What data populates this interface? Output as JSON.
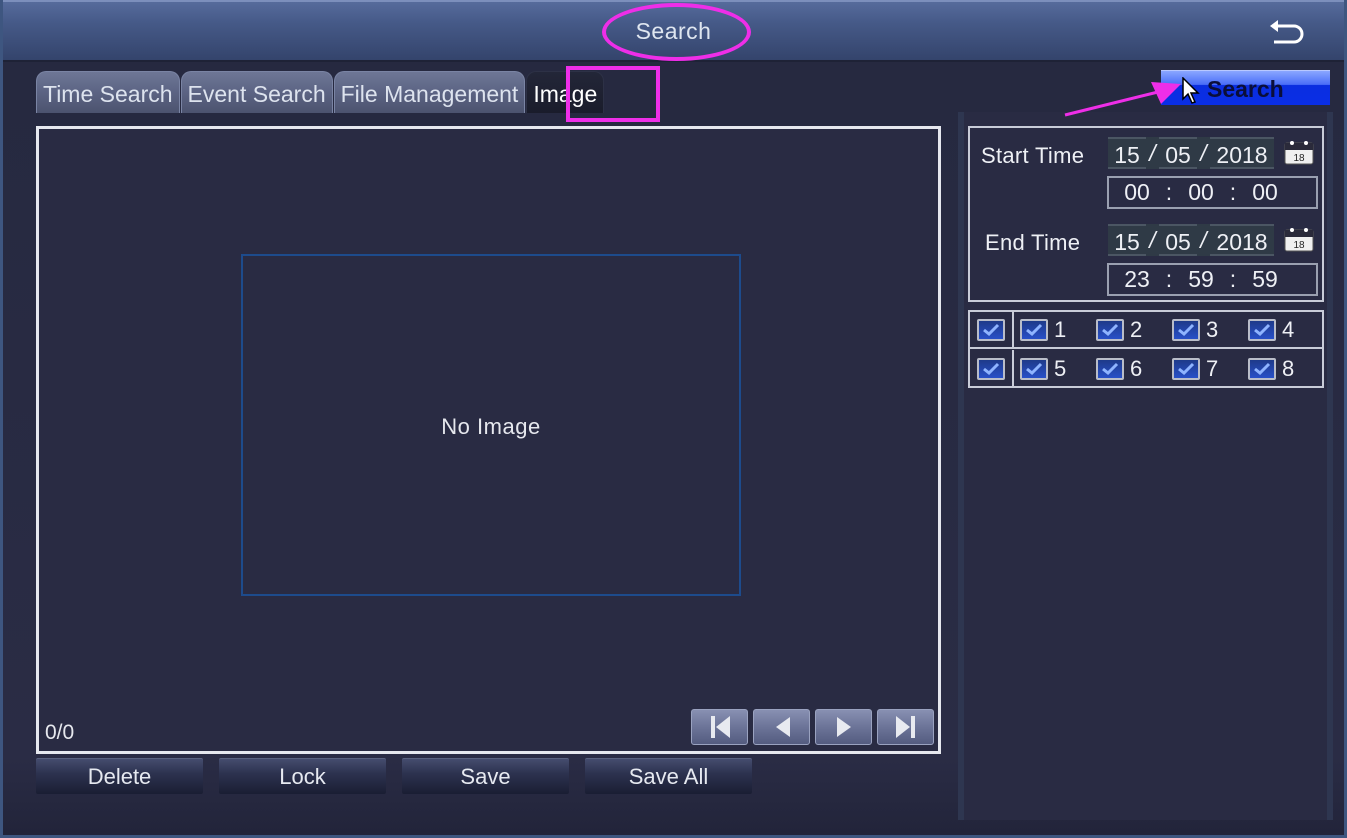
{
  "window": {
    "title": "Search",
    "back_icon": "return-arrow-icon"
  },
  "tabs": [
    {
      "label": "Time Search",
      "active": false
    },
    {
      "label": "Event Search",
      "active": false
    },
    {
      "label": "File Management",
      "active": false
    },
    {
      "label": "Image",
      "active": true
    }
  ],
  "preview": {
    "placeholder": "No Image",
    "counter": "0/0",
    "nav": [
      {
        "name": "first",
        "icon": "skip-first-icon"
      },
      {
        "name": "previous",
        "icon": "previous-icon"
      },
      {
        "name": "next",
        "icon": "next-icon"
      },
      {
        "name": "last",
        "icon": "skip-last-icon"
      }
    ]
  },
  "actions": {
    "delete": "Delete",
    "lock": "Lock",
    "save": "Save",
    "save_all": "Save All"
  },
  "search_panel": {
    "search_button": "Search",
    "start": {
      "label": "Start Time",
      "day": "15",
      "month": "05",
      "year": "2018",
      "hour": "00",
      "minute": "00",
      "second": "00"
    },
    "end": {
      "label": "End Time",
      "day": "15",
      "month": "05",
      "year": "2018",
      "hour": "23",
      "minute": "59",
      "second": "59"
    },
    "date_separator": "/",
    "time_separator": ":",
    "calendar_icon_day": "18",
    "channels": [
      {
        "label": "1",
        "checked": true
      },
      {
        "label": "2",
        "checked": true
      },
      {
        "label": "3",
        "checked": true
      },
      {
        "label": "4",
        "checked": true
      },
      {
        "label": "5",
        "checked": true
      },
      {
        "label": "6",
        "checked": true
      },
      {
        "label": "7",
        "checked": true
      },
      {
        "label": "8",
        "checked": true
      }
    ],
    "select_all_row1": true,
    "select_all_row2": true
  },
  "annotations": {
    "highlight_color": "#ee2ee8"
  },
  "colors": {
    "accent_blue": "#0a2ee6",
    "panel_bg": "#292b43",
    "titlebar": "#465a88"
  }
}
